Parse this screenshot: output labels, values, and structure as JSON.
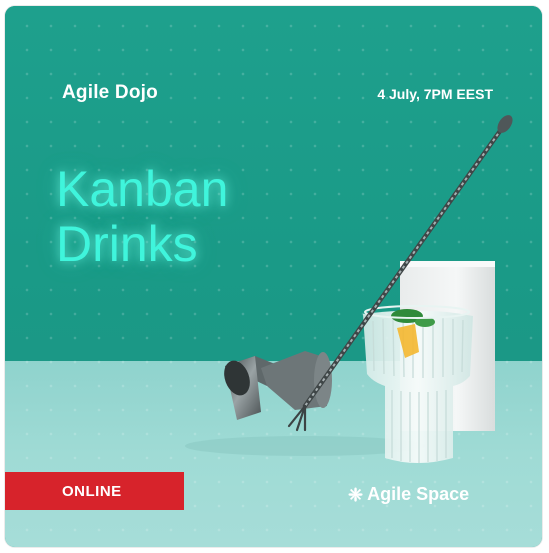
{
  "event": {
    "organizer": "Agile Dojo",
    "datetime": "4 July, 7PM EEST",
    "title_line1": "Kanban",
    "title_line2": "Drinks",
    "format_badge": "ONLINE",
    "brand": "Agile Space",
    "brand_icon": "molecule-icon"
  },
  "colors": {
    "wall": "#1c9f8c",
    "table": "#9fdbd5",
    "title_glow": "#3ff5dc",
    "badge": "#d7232b"
  }
}
